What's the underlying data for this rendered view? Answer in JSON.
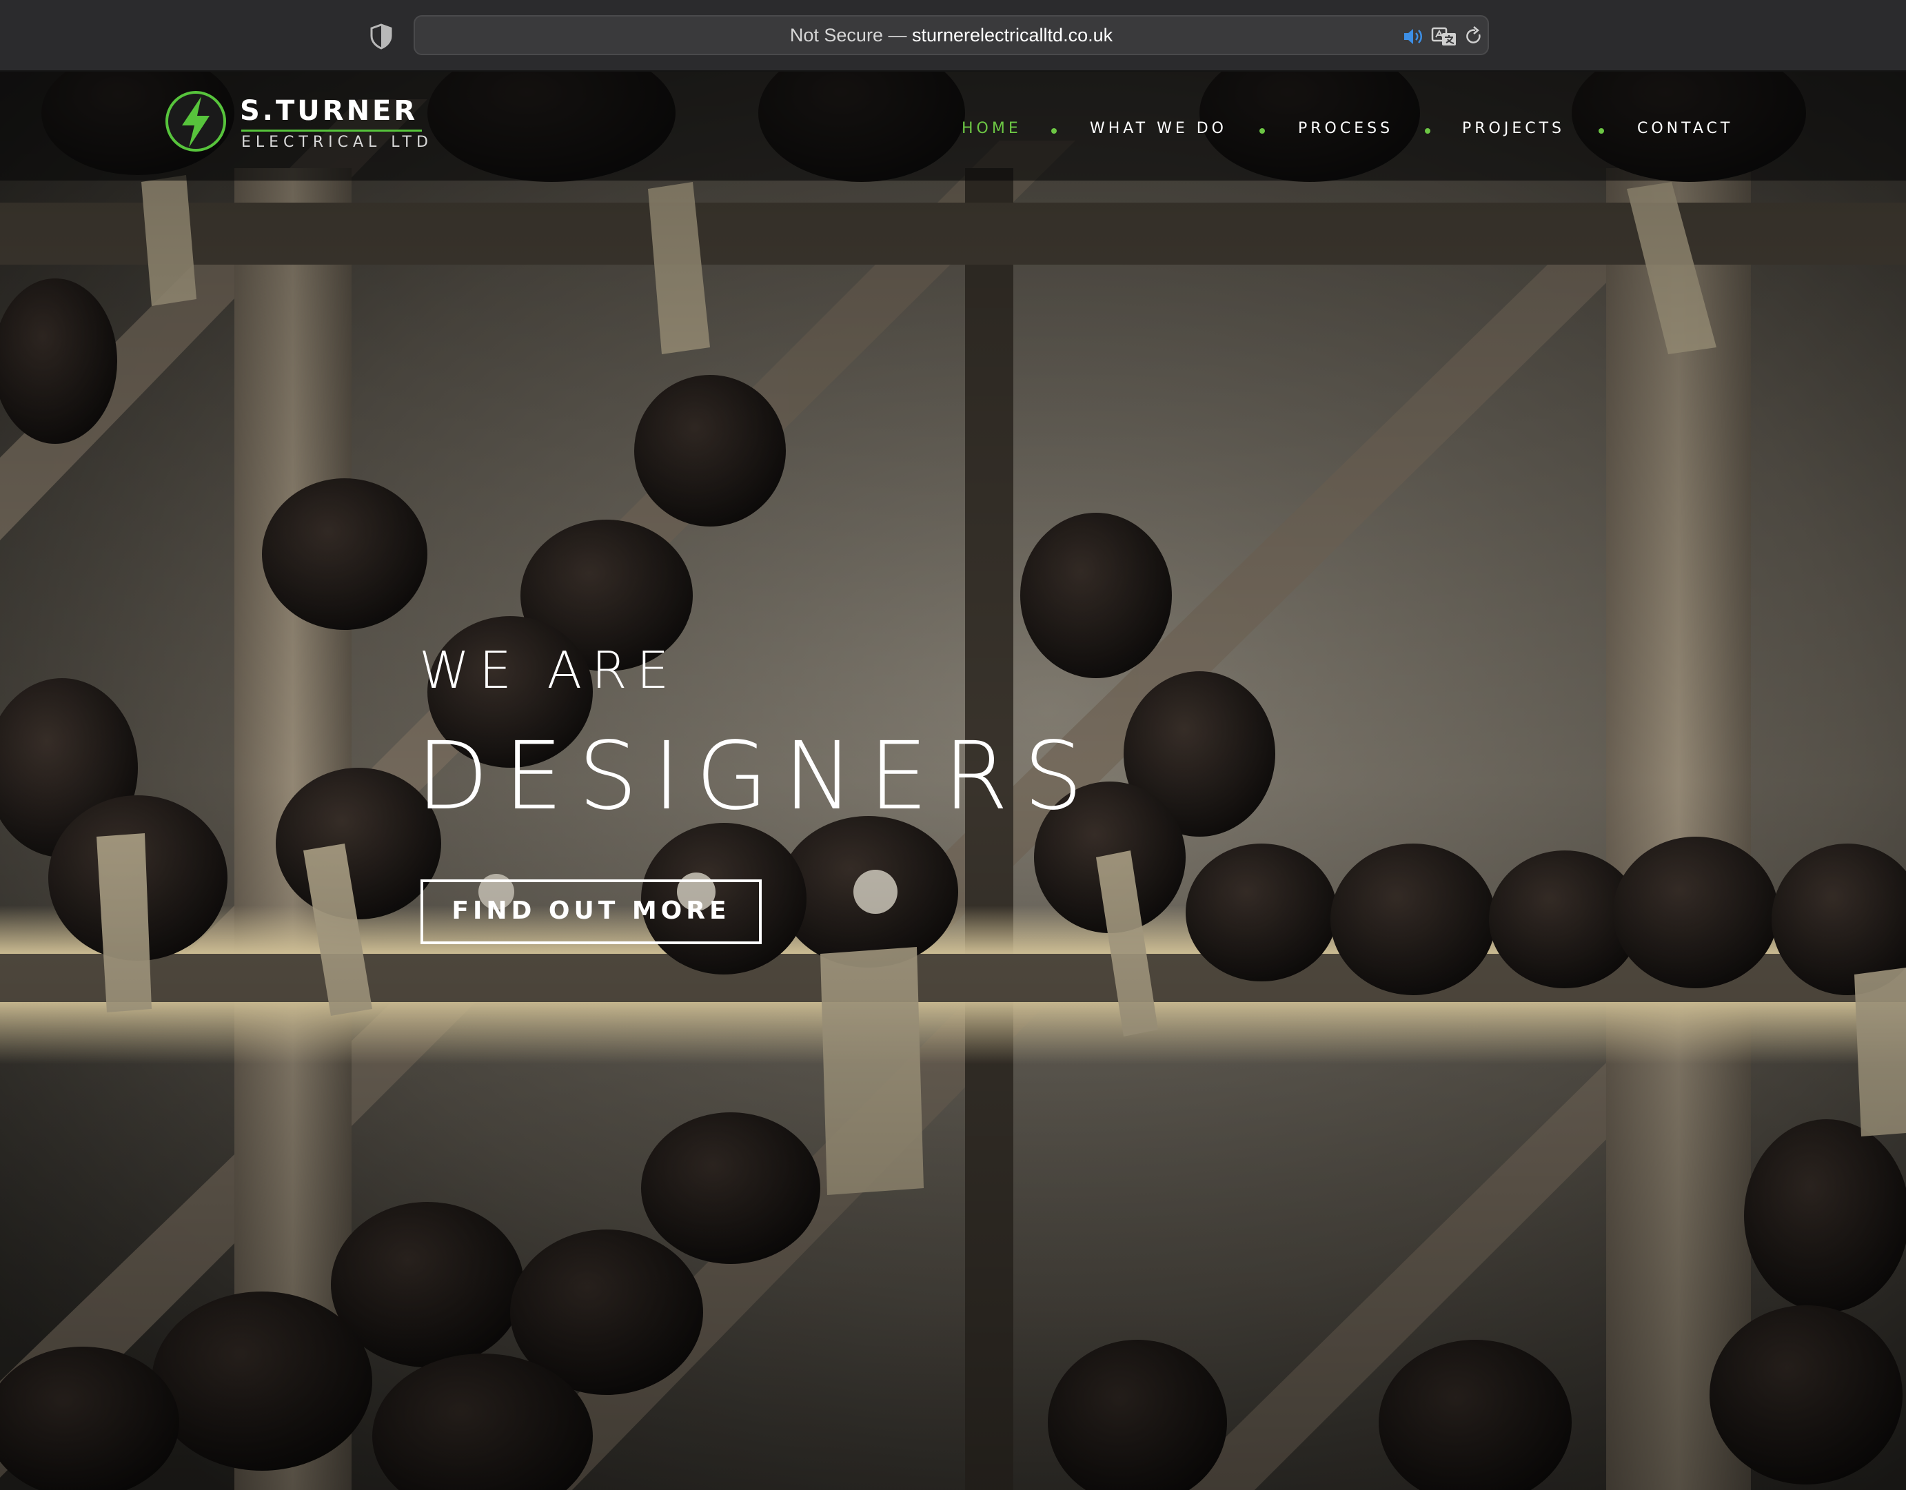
{
  "browser": {
    "url_prefix": "Not Secure —",
    "url_host": "sturnerelectricalltd.co.uk",
    "icons": [
      "privacy-shield-icon",
      "speaker-icon",
      "translate-icon",
      "reload-icon"
    ]
  },
  "logo": {
    "name": "S.TURNER",
    "subtitle": "ELECTRICAL LTD",
    "icon": "lightning-bolt-icon",
    "accent_color": "#57c43c"
  },
  "nav": {
    "items": [
      {
        "label": "HOME",
        "active": true
      },
      {
        "label": "WHAT WE DO",
        "active": false
      },
      {
        "label": "PROCESS",
        "active": false
      },
      {
        "label": "PROJECTS",
        "active": false
      },
      {
        "label": "CONTACT",
        "active": false
      }
    ],
    "active_color": "#6cc644",
    "separator": "green-dot"
  },
  "hero": {
    "eyebrow": "WE ARE",
    "title": "DESIGNERS",
    "cta_label": "FIND OUT MORE",
    "background": "wine-rack-photo"
  }
}
